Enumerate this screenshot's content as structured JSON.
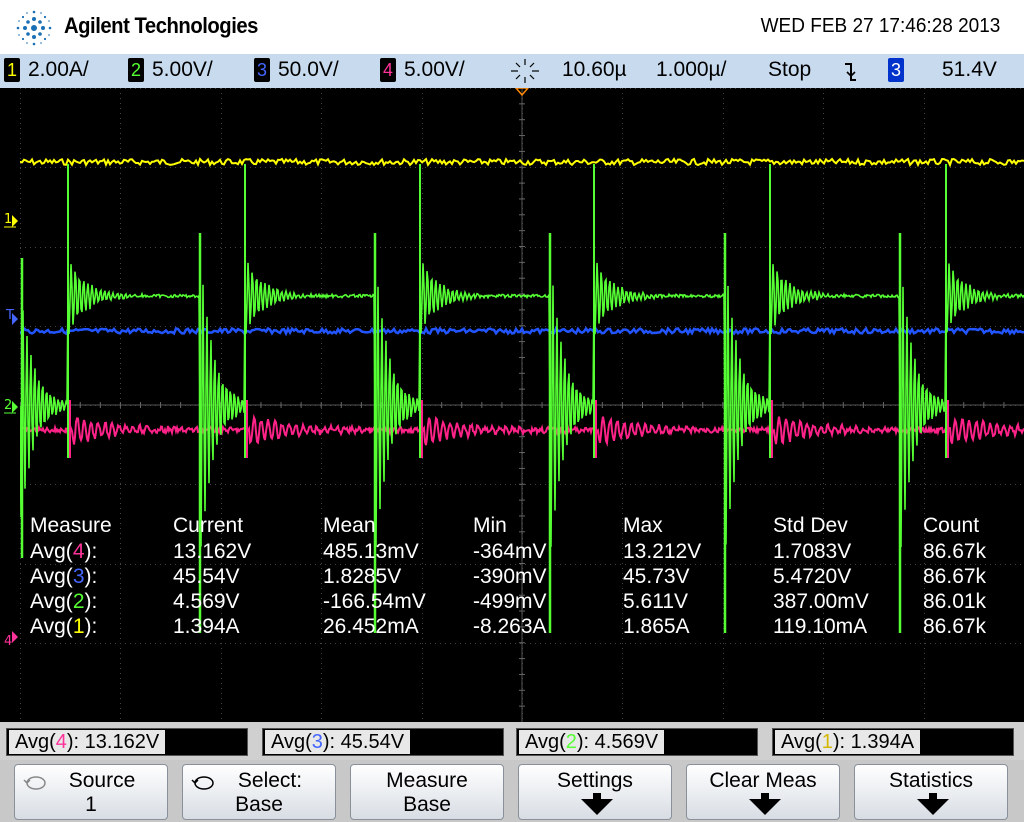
{
  "header": {
    "brand": "Agilent Technologies",
    "datetime": "WED FEB 27 17:46:28 2013"
  },
  "status_bar": {
    "ch1": {
      "num": "1",
      "scale": "2.00A/"
    },
    "ch2": {
      "num": "2",
      "scale": "5.00V/"
    },
    "ch3": {
      "num": "3",
      "scale": "50.0V/"
    },
    "ch4": {
      "num": "4",
      "scale": "5.00V/"
    },
    "time_position": "10.60µ",
    "time_scale": "1.000µ/",
    "run_state": "Stop",
    "trigger_slope_icon": "falling-edge-icon",
    "trigger_source": "3",
    "trigger_level": "51.4V"
  },
  "colors": {
    "ch1": "#ffff00",
    "ch2": "#55ff33",
    "ch3": "#2255ff",
    "ch4": "#ff2288",
    "status_bg": "#c8dbee"
  },
  "markers": {
    "ch1": "1",
    "trigger": "T",
    "ch2": "2",
    "ch4": "4"
  },
  "measurements": {
    "headers": [
      "Measure",
      "Current",
      "Mean",
      "Min",
      "Max",
      "Std Dev",
      "Count"
    ],
    "rows": [
      {
        "name_pre": "Avg(",
        "ch": "4",
        "name_post": "):",
        "current": "13.162V",
        "mean": "485.13mV",
        "min": "-364mV",
        "max": "13.212V",
        "std": "1.7083V",
        "count": "86.67k"
      },
      {
        "name_pre": "Avg(",
        "ch": "3",
        "name_post": "):",
        "current": "45.54V",
        "mean": "1.8285V",
        "min": "-390mV",
        "max": "45.73V",
        "std": "5.4720V",
        "count": "86.67k"
      },
      {
        "name_pre": "Avg(",
        "ch": "2",
        "name_post": "):",
        "current": "4.569V",
        "mean": "-166.54mV",
        "min": "-499mV",
        "max": "5.611V",
        "std": "387.00mV",
        "count": "86.01k"
      },
      {
        "name_pre": "Avg(",
        "ch": "1",
        "name_post": "):",
        "current": "1.394A",
        "mean": "26.452mA",
        "min": "-8.263A",
        "max": "1.865A",
        "std": "119.10mA",
        "count": "86.67k"
      }
    ]
  },
  "avg_readouts": [
    {
      "pre": "Avg(",
      "ch": "4",
      "post": "): 13.162V"
    },
    {
      "pre": "Avg(",
      "ch": "3",
      "post": "): 45.54V"
    },
    {
      "pre": "Avg(",
      "ch": "2",
      "post": "): 4.569V"
    },
    {
      "pre": "Avg(",
      "ch": "1",
      "post": "): 1.394A"
    }
  ],
  "softkeys": [
    {
      "line1": "Source",
      "line2": "1",
      "icon": "rotate-knob-icon"
    },
    {
      "line1": "Select:",
      "line2": "Base",
      "icon": "rotate-knob-icon"
    },
    {
      "line1": "Measure",
      "line2": "Base"
    },
    {
      "line1": "Settings",
      "icon": "down-arrow-icon"
    },
    {
      "line1": "Clear Meas",
      "icon": "down-arrow-icon"
    },
    {
      "line1": "Statistics",
      "icon": "down-arrow-icon"
    }
  ]
}
